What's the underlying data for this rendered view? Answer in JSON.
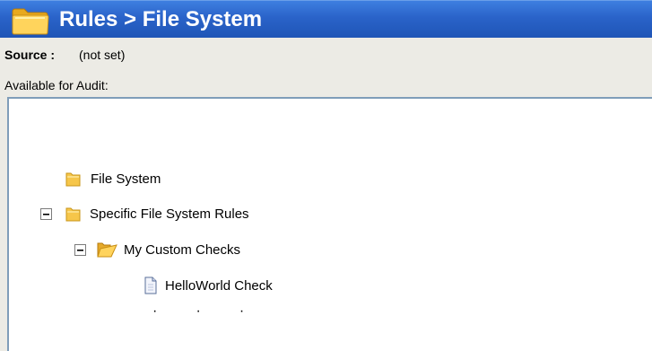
{
  "header": {
    "title": "Rules > File System",
    "icon": "folder-icon"
  },
  "source": {
    "label": "Source :",
    "value": "(not set)"
  },
  "available_label": "Available for Audit:",
  "tree": [
    {
      "label": "File System",
      "icon": "folder-closed-icon",
      "expanded": null
    },
    {
      "label": "Specific File System Rules",
      "icon": "folder-closed-icon",
      "expanded": true
    },
    {
      "label": "My Custom Checks",
      "icon": "folder-open-icon",
      "expanded": true
    },
    {
      "label": "HelloWorld Check",
      "icon": "document-icon",
      "expanded": null
    }
  ],
  "ellipsis": [
    "·",
    "·",
    "·"
  ],
  "colors": {
    "title_bar": "#2a63c9",
    "panel_bg": "#ecebe5",
    "folder": "#f6c64a",
    "border": "#7f9db9"
  }
}
